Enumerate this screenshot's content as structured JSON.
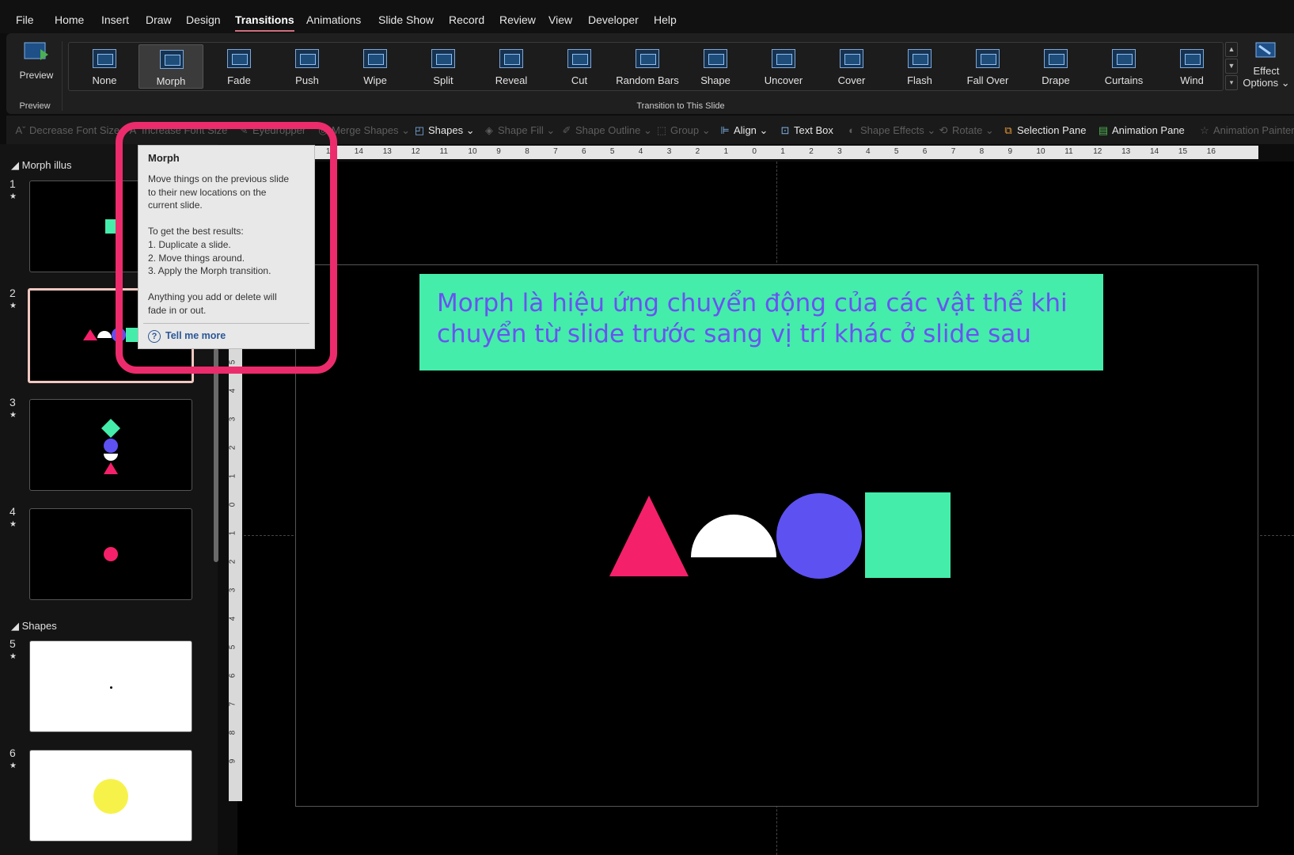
{
  "menu": [
    "File",
    "Home",
    "Insert",
    "Draw",
    "Design",
    "Transitions",
    "Animations",
    "Slide Show",
    "Record",
    "Review",
    "View",
    "Developer",
    "Help"
  ],
  "active_tab": "Transitions",
  "ribbon": {
    "preview_label": "Preview",
    "preview_group_label": "Preview",
    "transitions": [
      "None",
      "Morph",
      "Fade",
      "Push",
      "Wipe",
      "Split",
      "Reveal",
      "Cut",
      "Random Bars",
      "Shape",
      "Uncover",
      "Cover",
      "Flash",
      "Fall Over",
      "Drape",
      "Curtains",
      "Wind"
    ],
    "selected_transition": "Morph",
    "group_label": "Transition to This Slide",
    "effect_options_line1": "Effect",
    "effect_options_line2": "Options"
  },
  "toolbar": {
    "decrease_font": "Decrease Font Size",
    "increase_font": "Increase Font Size",
    "eyedropper": "Eyedropper",
    "merge_shapes": "Merge Shapes",
    "shapes": "Shapes",
    "shape_fill": "Shape Fill",
    "shape_outline": "Shape Outline",
    "group": "Group",
    "align": "Align",
    "text_box": "Text Box",
    "shape_effects": "Shape Effects",
    "rotate": "Rotate",
    "selection_pane": "Selection Pane",
    "animation_pane": "Animation Pane",
    "animation_painter": "Animation Painter"
  },
  "sidebar": {
    "section1": "Morph illus",
    "section2": "Shapes",
    "slide_numbers": [
      "1",
      "2",
      "3",
      "4",
      "5",
      "6"
    ]
  },
  "ruler": {
    "h_ticks": [
      "16",
      "15",
      "14",
      "13",
      "12",
      "11",
      "10",
      "9",
      "8",
      "7",
      "6",
      "5",
      "4",
      "3",
      "2",
      "1",
      "0",
      "1",
      "2",
      "3",
      "4",
      "5",
      "6",
      "7",
      "8",
      "9",
      "10",
      "11",
      "12",
      "13",
      "14",
      "15",
      "16"
    ],
    "v_ticks": [
      "5",
      "4",
      "3",
      "2",
      "1",
      "0",
      "1",
      "2",
      "3",
      "4",
      "5",
      "6",
      "7",
      "8",
      "9"
    ]
  },
  "slide": {
    "text_line1": "Morph là hiệu ứng chuyển động của các vật thể khi",
    "text_line2": "chuyển từ slide trước sang vị trí khác ở slide sau"
  },
  "tooltip": {
    "title": "Morph",
    "body": "Move things on the previous slide\nto their new locations on the\ncurrent slide.\n\nTo get the best results:\n1. Duplicate a slide.\n2. Move things around.\n3. Apply the Morph transition.\n\nAnything you add or delete will\nfade in or out.",
    "link": "Tell me more"
  },
  "colors": {
    "pink": "#f5206a",
    "white": "#ffffff",
    "purple": "#5e51f2",
    "green": "#44edaa",
    "yellow": "#f7f24a",
    "accent": "#ec2b6d"
  }
}
